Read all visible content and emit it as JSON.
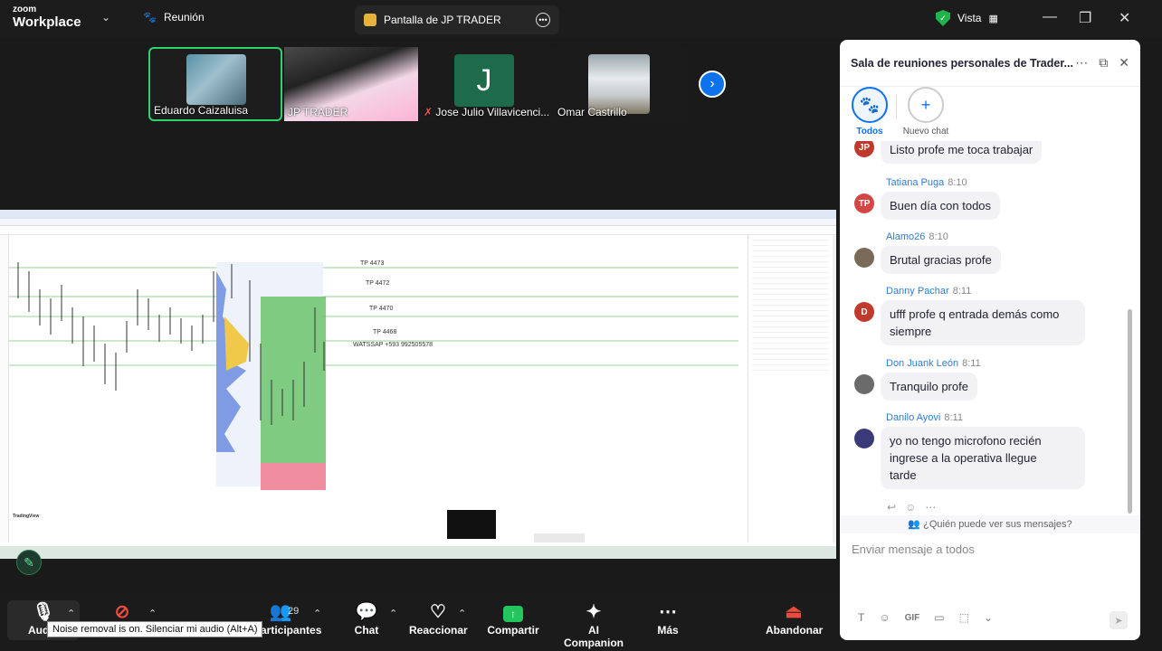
{
  "topbar": {
    "logo_line1": "zoom",
    "logo_line2": "Workplace",
    "meeting_label": "Reunión",
    "share_tab_label": "Pantalla de JP TRADER",
    "view_label": "Vista"
  },
  "participants": [
    {
      "name": "Eduardo Caizaluisa"
    },
    {
      "name": "JP TRADER"
    },
    {
      "name": "Jose Julio Villavicenci...",
      "initial": "J"
    },
    {
      "name": "Omar Castrillo"
    }
  ],
  "shared_screen": {
    "tp_labels": [
      "TP 4473",
      "TP 4472",
      "TP 4470",
      "TP 4468"
    ],
    "contact_label": "WATSSAP +593 992505578",
    "watermark": "TradingView"
  },
  "toolbar": {
    "audio_label": "Audio",
    "participants_label": "Participantes",
    "participants_count": "29",
    "chat_label": "Chat",
    "react_label": "Reaccionar",
    "share_label": "Compartir",
    "companion_label": "AI Companion",
    "more_label": "Más",
    "leave_label": "Abandonar",
    "tooltip": "Noise removal is on. Silenciar mi audio (Alt+A)"
  },
  "chat": {
    "title": "Sala de reuniones personales de Trader...",
    "tabs": [
      {
        "label": "Todos",
        "icon": "paw-icon"
      },
      {
        "label": "Nuevo chat",
        "icon": "plus-icon"
      }
    ],
    "messages": [
      {
        "initials": "JP",
        "color": "#c0392b",
        "sender": "",
        "time": "",
        "text": "Listo profe me toca trabajar"
      },
      {
        "initials": "TP",
        "color": "#d64545",
        "sender": "Tatiana Puga",
        "time": "8:10",
        "text": "Buen día con todos"
      },
      {
        "initials": "",
        "color": "#7a6a5a",
        "sender": "Alamo26",
        "time": "8:10",
        "text": "Brutal gracias profe"
      },
      {
        "initials": "D",
        "color": "#c0392b",
        "sender": "Danny Pachar",
        "time": "8:11",
        "text_lines": [
          "ufff profe q entrada demás como",
          "siempre"
        ]
      },
      {
        "initials": "",
        "color": "#6b6b6b",
        "sender": "Don Juank León",
        "time": "8:11",
        "text": "Tranquilo profe"
      },
      {
        "initials": "",
        "color": "#3a3a7a",
        "sender": "Danilo Ayovi",
        "time": "8:11",
        "text_lines": [
          "yo no tengo microfono recién",
          "ingrese a la operativa llegue",
          "tarde"
        ]
      }
    ],
    "who_can_see": "¿Quién puede ver sus mensajes?",
    "input_placeholder": "Enviar mensaje a todos",
    "gif_label": "GIF"
  }
}
